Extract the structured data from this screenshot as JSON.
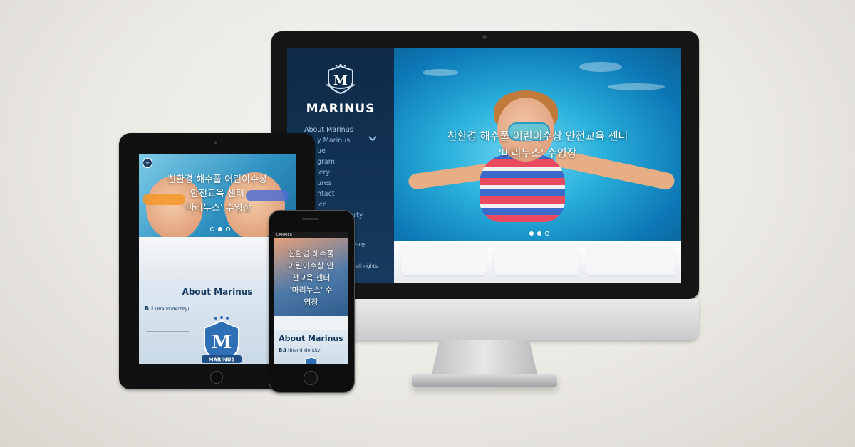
{
  "desktop": {
    "brand": "MARINUS",
    "nav": [
      "About Marinus",
      "y Marinus",
      "ue",
      "gram",
      "lery",
      "ures",
      "ntact",
      "ice",
      "Party"
    ],
    "sidebar_address_fragment": "2-1층",
    "sidebar_copyright_fragment": "S all rights",
    "hero_caption_line1": "친환경 해수풀 어린이수상 안전교육 센터",
    "hero_caption_line2": "'마리누스' 수영장"
  },
  "tablet": {
    "menu_icon": "≡",
    "hero_caption_line1": "친환경 해수풀 어린이수상",
    "hero_caption_line2": "안전교육 센터",
    "hero_caption_line3": "'마리누스' 수영장",
    "about_title": "About Marinus",
    "bi_label": "B.I",
    "bi_sub": "(Brand Identity)",
    "brand": "MARINUS"
  },
  "phone": {
    "status_text": "CARRIER",
    "hero_caption_line1": "친환경 해수풀",
    "hero_caption_line2": "어린이수상 안",
    "hero_caption_line3": "전교육 센터",
    "hero_caption_line4": "'마리누스' 수",
    "hero_caption_line5": "영장",
    "about_title": "About Marinus",
    "bi_label": "B.I",
    "bi_sub": "(Brand Identity)"
  },
  "colors": {
    "navy": "#0e2a48",
    "nav_text": "#8fb4d8",
    "water": "#2ab1dd"
  }
}
